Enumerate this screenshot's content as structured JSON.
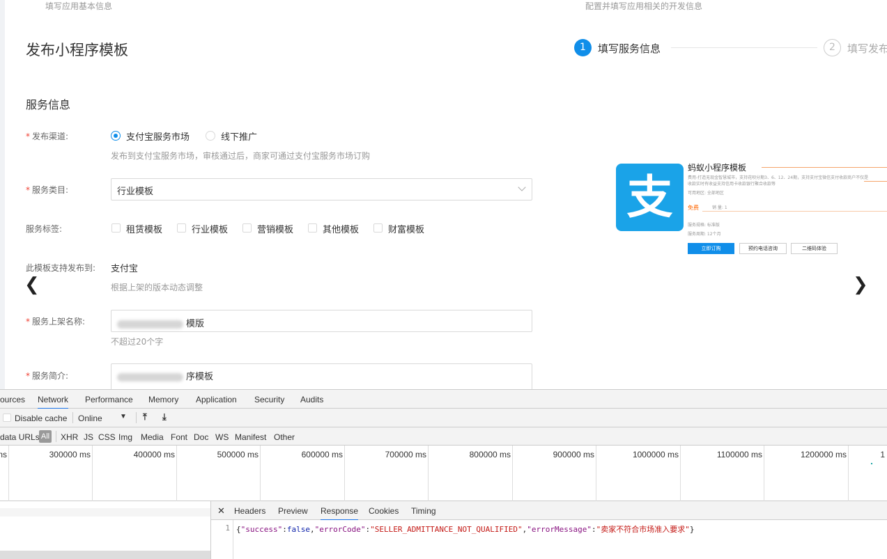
{
  "top_hints": {
    "left": "填写应用基本信息",
    "right": "配置并填写应用相关的开发信息"
  },
  "page_title": "发布小程序模板",
  "steps": [
    {
      "num": "1",
      "label": "填写服务信息"
    },
    {
      "num": "2",
      "label": "填写发布"
    }
  ],
  "section_title": "服务信息",
  "form": {
    "channel": {
      "label": "发布渠道:",
      "options": [
        "支付宝服务市场",
        "线下推广"
      ],
      "help": "发布到支付宝服务市场，审核通过后，商家可通过支付宝服务市场订购"
    },
    "category": {
      "label": "服务类目:",
      "value": "行业模板"
    },
    "tags": {
      "label": "服务标签:",
      "options": [
        "租赁模板",
        "行业模板",
        "营销模板",
        "其他模板",
        "财富模板"
      ]
    },
    "platform": {
      "label": "此模板支持发布到:",
      "value": "支付宝",
      "help": "根据上架的版本动态调整"
    },
    "name": {
      "label": "服务上架名称:",
      "value_suffix": "模版",
      "help": "不超过20个字"
    },
    "intro": {
      "label": "服务简介:",
      "value_suffix": "序模板"
    }
  },
  "preview": {
    "logo_char": "支",
    "title": "蚂蚁小程序模板",
    "desc1": "费用-打造无现金智慧城市，支持花呗分期3、6、12、24期，支持支付宝微信支付收款商户不仅是",
    "desc2": "收款实时有收益支持信用卡收款银行聚合收款等",
    "area": "可用地区:    全部地区",
    "free": "免费",
    "sales": "销    量:    1",
    "spec": "服务规格:    标准版",
    "period": "服务周期:    12个月",
    "buttons": [
      "立即订购",
      "预约电话咨询",
      "二维码体验"
    ]
  },
  "devtools": {
    "tabs": [
      "ources",
      "Network",
      "Performance",
      "Memory",
      "Application",
      "Security",
      "Audits"
    ],
    "active_tab": "Network",
    "toolbar": {
      "disable_cache": "Disable cache",
      "throttle": "Online"
    },
    "filters": [
      "data URLs",
      "All",
      "XHR",
      "JS",
      "CSS",
      "Img",
      "Media",
      "Font",
      "Doc",
      "WS",
      "Manifest",
      "Other"
    ],
    "timeline_ticks": [
      "ms",
      "300000 ms",
      "400000 ms",
      "500000 ms",
      "600000 ms",
      "700000 ms",
      "800000 ms",
      "900000 ms",
      "1000000 ms",
      "1100000 ms",
      "1200000 ms",
      "1"
    ],
    "detail_tabs": [
      "Headers",
      "Preview",
      "Response",
      "Cookies",
      "Timing"
    ],
    "active_detail_tab": "Response",
    "response": {
      "line_no": "1",
      "success_key": "\"success\"",
      "success_val": "false",
      "code_key": "\"errorCode\"",
      "code_val": "\"SELLER_ADMITTANCE_NOT_QUALIFIED\"",
      "msg_key": "\"errorMessage\"",
      "msg_val": "\"卖家不符合市场准入要求\""
    }
  }
}
